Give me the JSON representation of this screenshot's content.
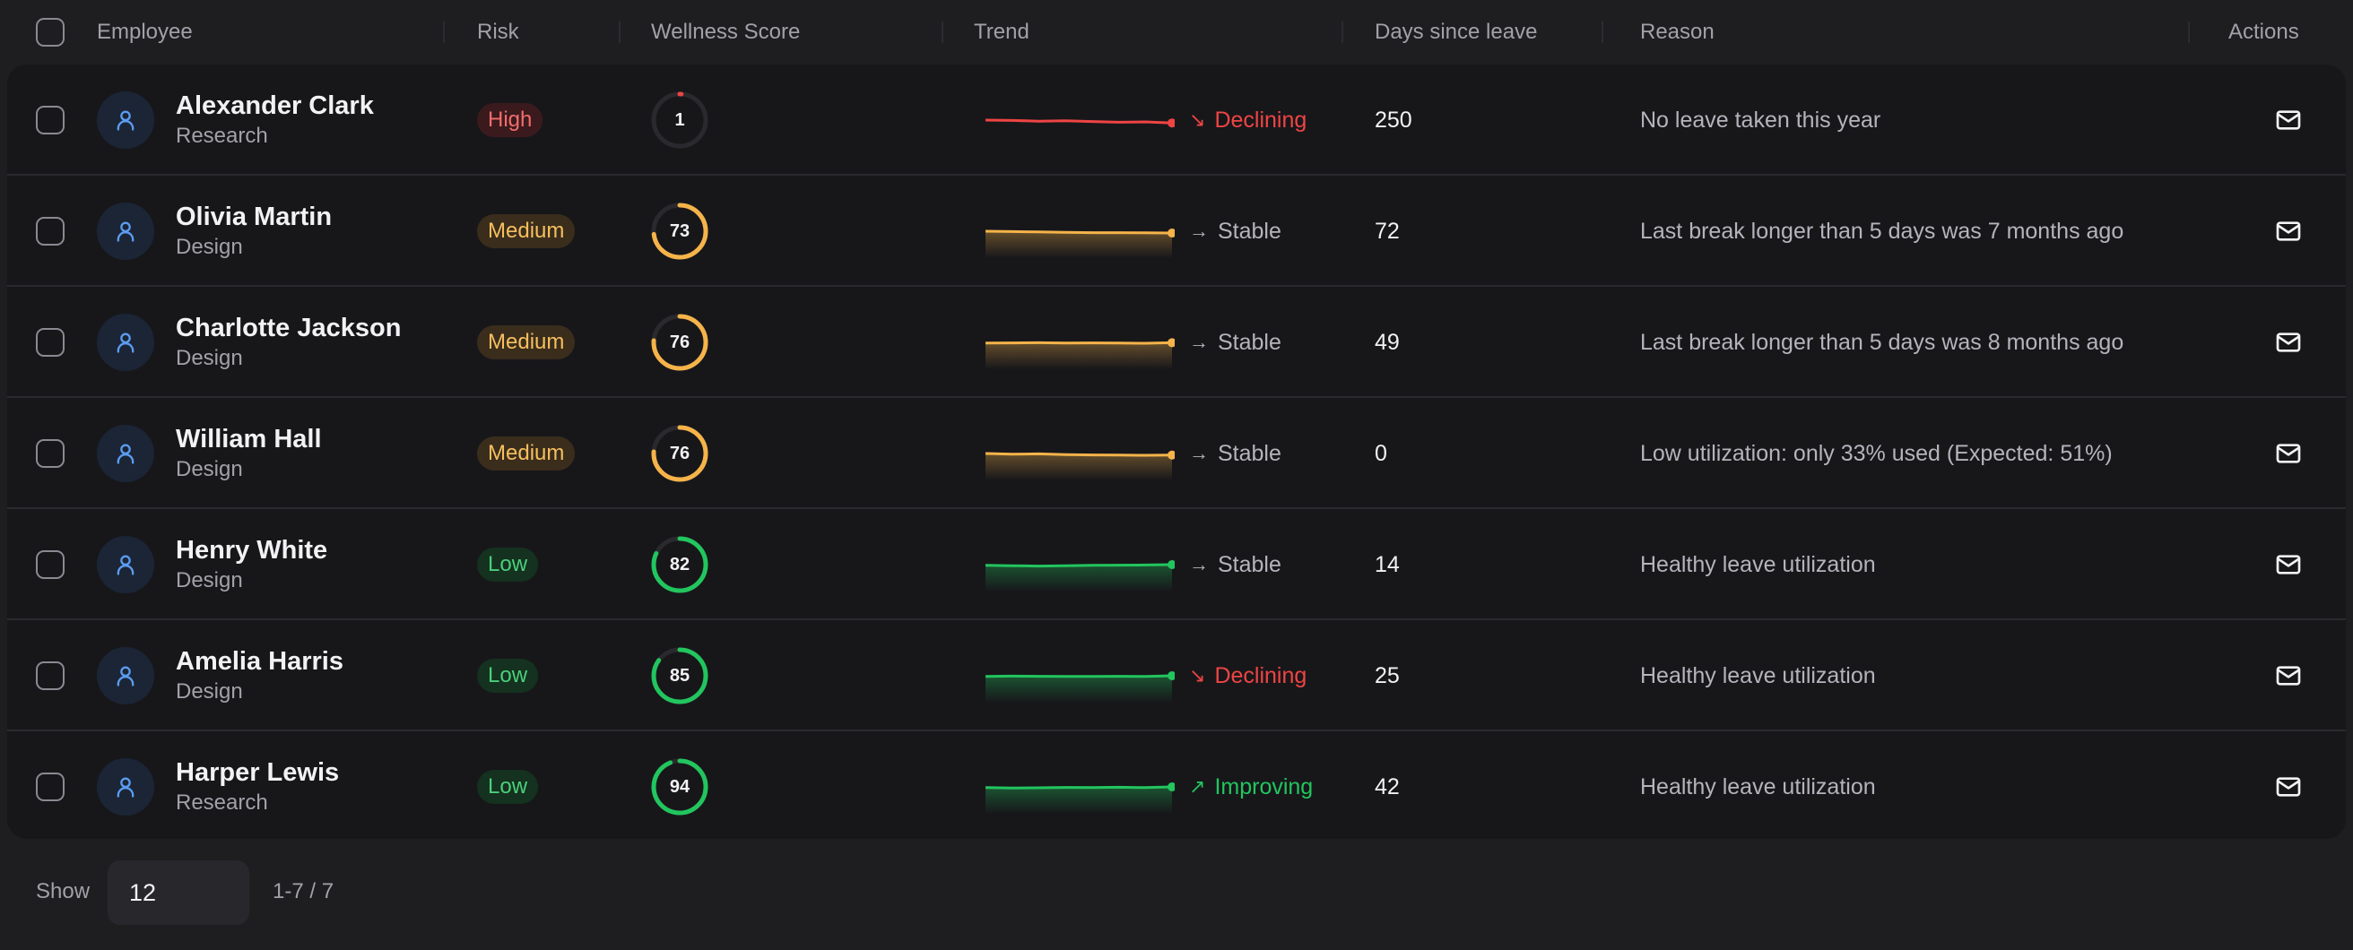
{
  "columns": {
    "employee": "Employee",
    "risk": "Risk",
    "wellness": "Wellness Score",
    "trend": "Trend",
    "days": "Days since leave",
    "reason": "Reason",
    "actions": "Actions"
  },
  "colors": {
    "high": "#ef4444",
    "medium": "#f5b34a",
    "low": "#22c55e",
    "declining": "#ef4444",
    "stable": "#b4b4bb",
    "improving": "#22c55e"
  },
  "rows": [
    {
      "name": "Alexander Clark",
      "dept": "Research",
      "risk": "High",
      "risk_level": "high",
      "score": "1",
      "trend": "Declining",
      "trend_kind": "declining",
      "trend_arrow": "↘",
      "days": "250",
      "reason": "No leave taken this year"
    },
    {
      "name": "Olivia Martin",
      "dept": "Design",
      "risk": "Medium",
      "risk_level": "medium",
      "score": "73",
      "trend": "Stable",
      "trend_kind": "stable",
      "trend_arrow": "→",
      "days": "72",
      "reason": "Last break longer than 5 days was 7 months ago"
    },
    {
      "name": "Charlotte Jackson",
      "dept": "Design",
      "risk": "Medium",
      "risk_level": "medium",
      "score": "76",
      "trend": "Stable",
      "trend_kind": "stable",
      "trend_arrow": "→",
      "days": "49",
      "reason": "Last break longer than 5 days was 8 months ago"
    },
    {
      "name": "William Hall",
      "dept": "Design",
      "risk": "Medium",
      "risk_level": "medium",
      "score": "76",
      "trend": "Stable",
      "trend_kind": "stable",
      "trend_arrow": "→",
      "days": "0",
      "reason": "Low utilization: only 33% used (Expected: 51%)"
    },
    {
      "name": "Henry White",
      "dept": "Design",
      "risk": "Low",
      "risk_level": "low",
      "score": "82",
      "trend": "Stable",
      "trend_kind": "stable",
      "trend_arrow": "→",
      "days": "14",
      "reason": "Healthy leave utilization"
    },
    {
      "name": "Amelia Harris",
      "dept": "Design",
      "risk": "Low",
      "risk_level": "low",
      "score": "85",
      "trend": "Declining",
      "trend_kind": "declining",
      "trend_arrow": "↘",
      "days": "25",
      "reason": "Healthy leave utilization"
    },
    {
      "name": "Harper Lewis",
      "dept": "Research",
      "risk": "Low",
      "risk_level": "low",
      "score": "94",
      "trend": "Improving",
      "trend_kind": "improving",
      "trend_arrow": "↗",
      "days": "42",
      "reason": "Healthy leave utilization"
    }
  ],
  "footer": {
    "show_label": "Show",
    "page_size": "12",
    "range": "1-7 / 7"
  }
}
